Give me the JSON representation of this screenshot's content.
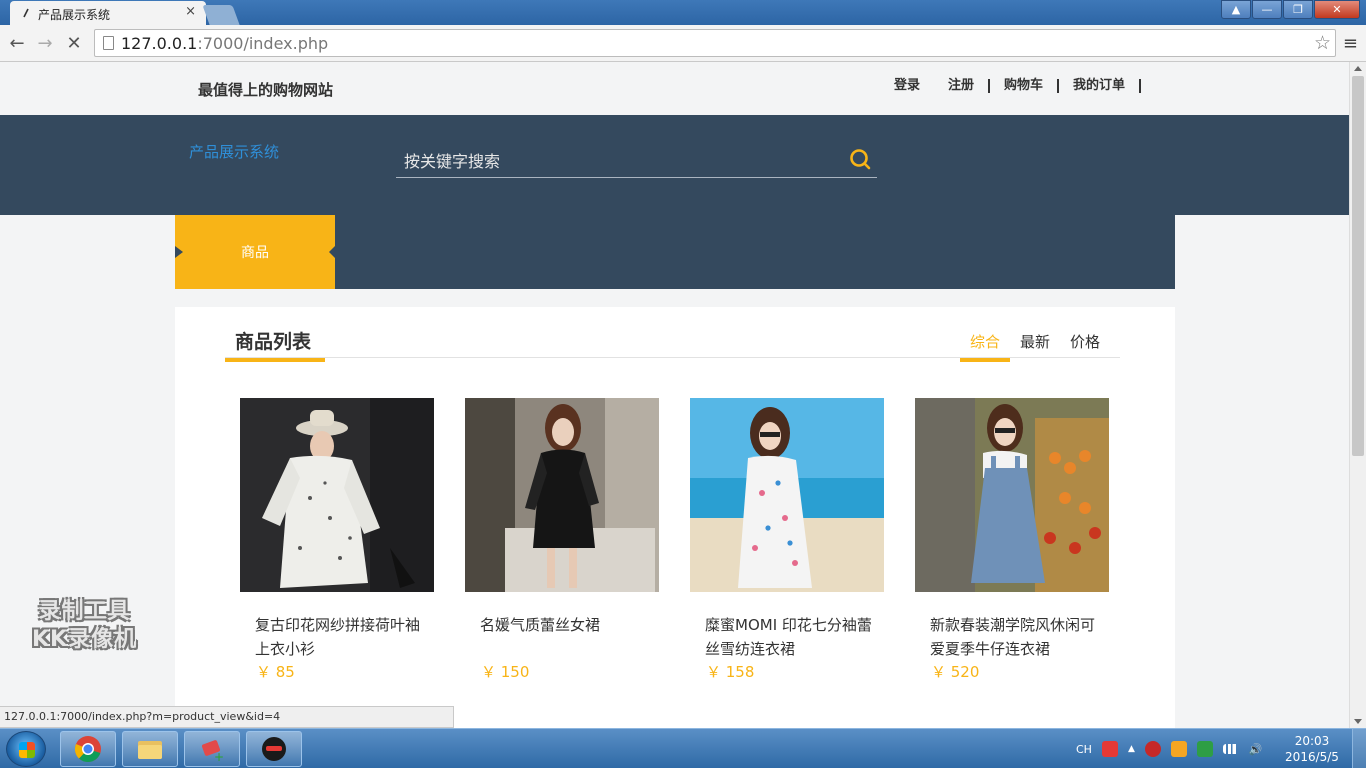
{
  "browser": {
    "tab_title": "产品展示系统",
    "tab_close": "×",
    "url_host": "127.0.0.1",
    "url_rest": ":7000/index.php",
    "status_url": "127.0.0.1:7000/index.php?m=product_view&id=4"
  },
  "site": {
    "slogan": "最值得上的购物网站",
    "top_links": [
      "登录",
      "注册",
      "购物车",
      "我的订单"
    ],
    "logo_text": "产品展示系统",
    "search_placeholder": "按关键字搜索",
    "nav_item": "商品"
  },
  "products_section": {
    "title": "商品列表",
    "sort_tabs": [
      "综合",
      "最新",
      "价格"
    ],
    "active_sort": "综合",
    "items": [
      {
        "name": "复古印花网纱拼接荷叶袖上衣小衫",
        "price": "￥ 85"
      },
      {
        "name": "名媛气质蕾丝女裙",
        "price": "￥ 150"
      },
      {
        "name": "糜蜜MOMI 印花七分袖蕾丝雪纺连衣裙",
        "price": "￥ 158"
      },
      {
        "name": "新款春装潮学院风休闲可爱夏季牛仔连衣裙",
        "price": "￥ 520"
      }
    ]
  },
  "watermark": {
    "line1": "录制工具",
    "line2": "KK录像机"
  },
  "taskbar": {
    "ime": "CH",
    "time": "20:03",
    "date": "2016/5/5"
  },
  "colors": {
    "accent": "#f8b417",
    "header_bg": "#34495e",
    "logo_blue": "#2f8fd8"
  }
}
